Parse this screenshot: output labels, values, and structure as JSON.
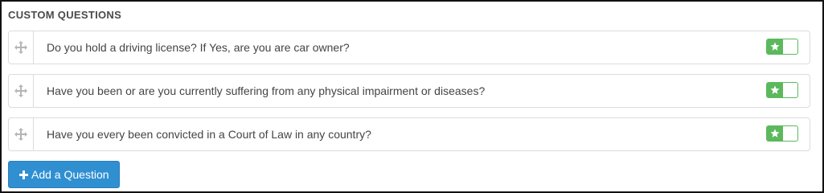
{
  "section": {
    "title": "CUSTOM QUESTIONS"
  },
  "questions": [
    {
      "text": "Do you hold a driving license? If Yes, are you are car owner?",
      "enabled": true
    },
    {
      "text": "Have you been or are you currently suffering from any physical impairment or diseases?",
      "enabled": true
    },
    {
      "text": "Have you every been convicted in a Court of Law in any country?",
      "enabled": true
    }
  ],
  "icons": {
    "drag": "move-arrows-icon",
    "toggle": "star-icon",
    "add": "plus-icon"
  },
  "actions": {
    "add_question_label": "Add a Question"
  },
  "colors": {
    "toggle_on": "#5cb85c",
    "primary_button": "#2f8fd1",
    "border": "#dcdcdc",
    "text": "#444444"
  }
}
